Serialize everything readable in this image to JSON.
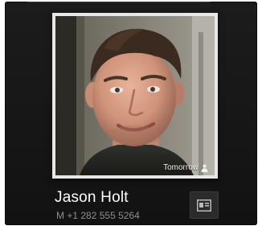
{
  "contact": {
    "name": "Jason Holt",
    "phone_type": "M",
    "phone_number": "+1 282 555 5264",
    "photo_caption": "Tomorrow",
    "caption_icon": "person-icon",
    "action_icon": "contact-card-icon"
  },
  "colors": {
    "background": "#161616",
    "name_text": "#ffffff",
    "phone_text": "#8e8e8e",
    "photo_border": "#e7e7e7"
  }
}
